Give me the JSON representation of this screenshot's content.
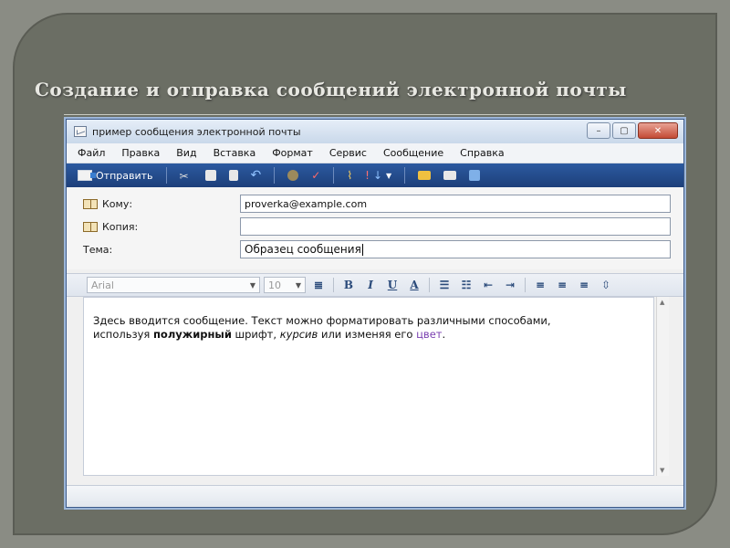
{
  "slide": {
    "title": "Создание и отправка сообщений электронной почты"
  },
  "window": {
    "title": "пример сообщения электронной почты",
    "controls": {
      "minimize": "–",
      "maximize": "▢",
      "close": "✕"
    }
  },
  "menu": [
    "Файл",
    "Правка",
    "Вид",
    "Вставка",
    "Формат",
    "Сервис",
    "Сообщение",
    "Справка"
  ],
  "toolbar": {
    "send_label": "Отправить"
  },
  "headers": {
    "to_label": "Кому:",
    "to_value": "proverka@example.com",
    "cc_label": "Копия:",
    "cc_value": "",
    "subject_label": "Тема:",
    "subject_value": "Образец сообщения"
  },
  "format": {
    "font": "Arial",
    "size": "10"
  },
  "body": {
    "text1": "Здесь вводится сообщение. Текст можно форматировать различными способами,",
    "text2_prefix": "используя ",
    "bold": "полужирный",
    "text2_mid": " шрифт, ",
    "italic": "курсив",
    "text2_mid2": " или изменяя его ",
    "colored": "цвет",
    "text2_end": "."
  },
  "colors": {
    "toolbar_bg": "#2c5aa0",
    "colored_text": "#7a3fb0",
    "slide_bg": "#6b6e64"
  }
}
